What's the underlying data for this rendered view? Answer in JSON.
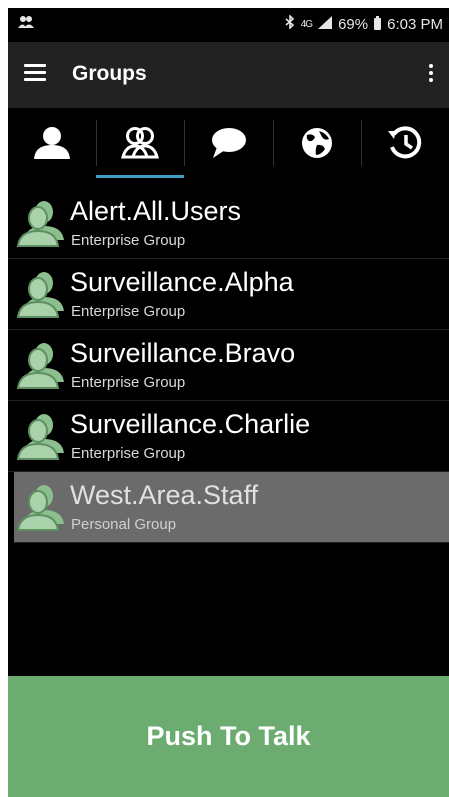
{
  "status_bar": {
    "app_icon": "group-icon",
    "bluetooth_icon": "bluetooth-icon",
    "network": "4G",
    "signal_icon": "signal-icon",
    "battery": "69%",
    "battery_icon": "battery-icon",
    "time": "6:03 PM"
  },
  "app_bar": {
    "menu_icon": "hamburger-menu-icon",
    "title": "Groups",
    "overflow_icon": "overflow-menu-icon"
  },
  "tabs": [
    {
      "icon": "contact-icon",
      "active": false
    },
    {
      "icon": "groups-icon",
      "active": true
    },
    {
      "icon": "chat-icon",
      "active": false
    },
    {
      "icon": "globe-icon",
      "active": false
    },
    {
      "icon": "history-icon",
      "active": false
    }
  ],
  "groups": [
    {
      "name": "Alert.All.Users",
      "type": "Enterprise Group",
      "selected": false
    },
    {
      "name": "Surveillance.Alpha",
      "type": "Enterprise Group",
      "selected": false
    },
    {
      "name": "Surveillance.Bravo",
      "type": "Enterprise Group",
      "selected": false
    },
    {
      "name": "Surveillance.Charlie",
      "type": "Enterprise Group",
      "selected": false
    },
    {
      "name": "West.Area.Staff",
      "type": "Personal Group",
      "selected": true
    }
  ],
  "push_to_talk": {
    "label": "Push To Talk"
  },
  "colors": {
    "accent": "#3f9ec6",
    "ptt_green": "#6cac70",
    "group_icon_green": "#8cbf8e",
    "selected_row": "#6b6b6b"
  }
}
